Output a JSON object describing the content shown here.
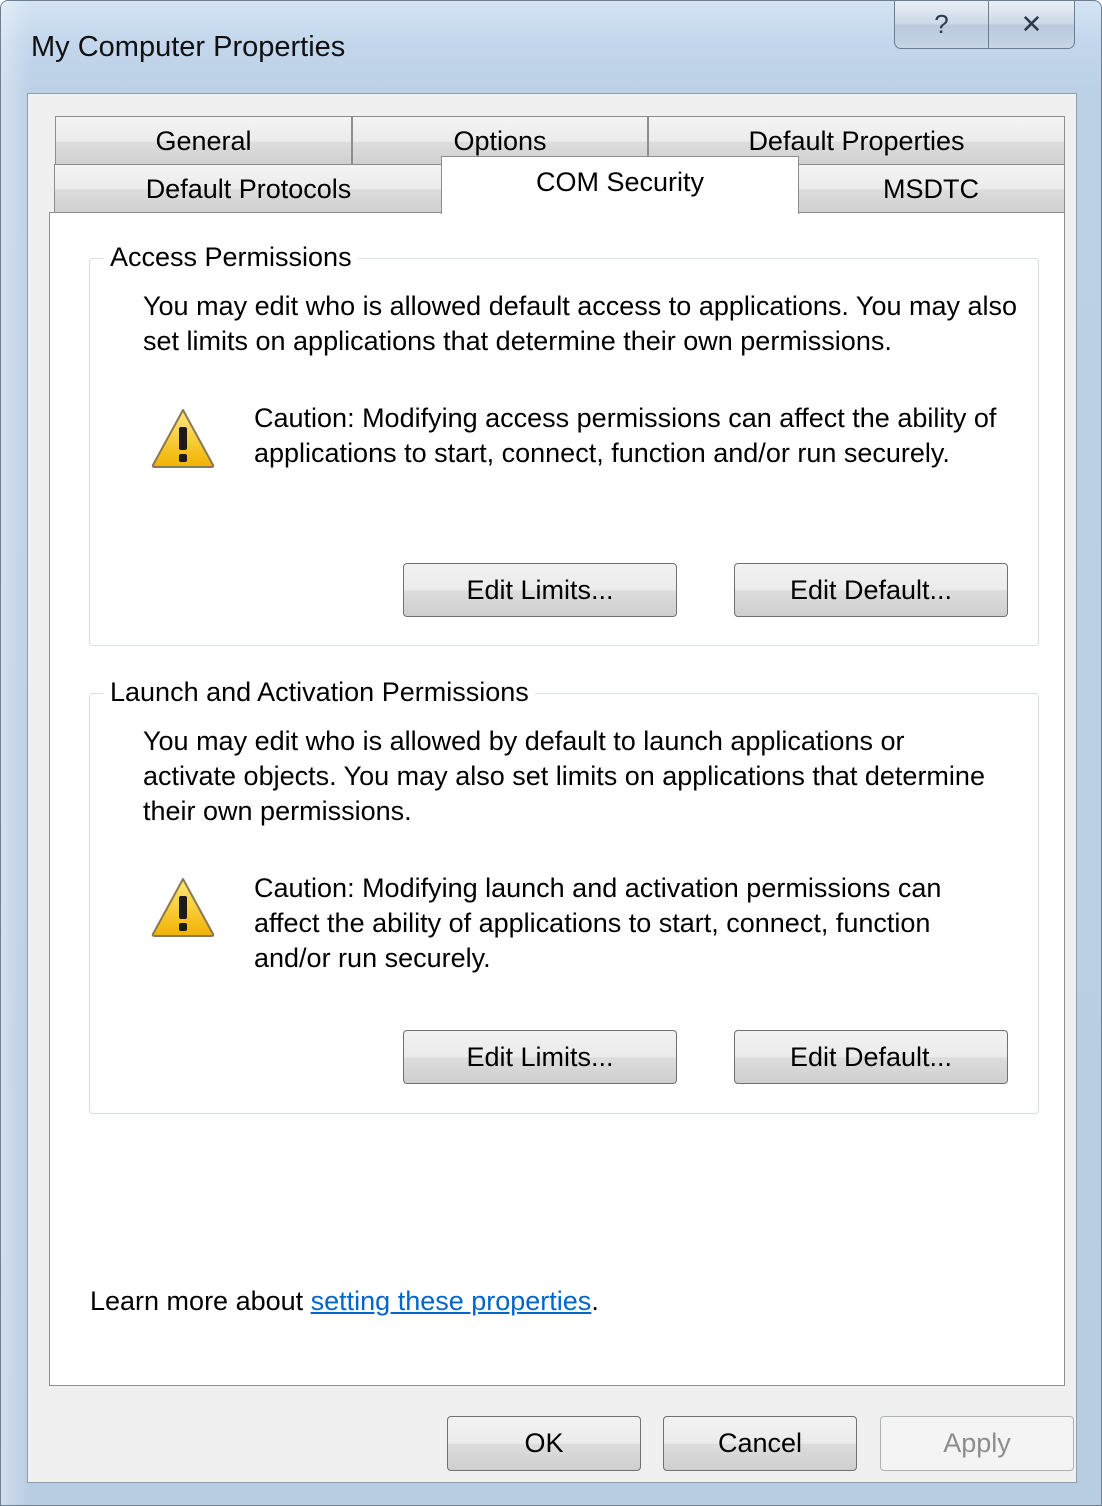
{
  "window": {
    "title": "My Computer Properties",
    "help_glyph": "?",
    "close_glyph": "✕"
  },
  "tabs": {
    "row1": [
      "General",
      "Options",
      "Default Properties"
    ],
    "row2": [
      "Default Protocols",
      "COM Security",
      "MSDTC"
    ],
    "selected": "COM Security"
  },
  "access": {
    "title": "Access Permissions",
    "description": "You may edit who is allowed default access to applications. You may also set limits on applications that determine their own permissions.",
    "caution": "Caution: Modifying access permissions can affect the ability of applications to start, connect, function and/or run securely.",
    "edit_limits_label": "Edit Limits...",
    "edit_default_label": "Edit Default..."
  },
  "launch": {
    "title": "Launch and Activation Permissions",
    "description": "You may edit who is allowed by default to launch applications or activate objects. You may also set limits on applications that determine their own permissions.",
    "caution": "Caution: Modifying launch and activation permissions can affect the ability of applications to start, connect, function and/or run securely.",
    "edit_limits_label": "Edit Limits...",
    "edit_default_label": "Edit Default..."
  },
  "learn_more": {
    "prefix": "Learn more about ",
    "link": "setting these properties",
    "suffix": "."
  },
  "footer": {
    "ok_label": "OK",
    "cancel_label": "Cancel",
    "apply_label": "Apply",
    "apply_enabled": false
  },
  "icons": {
    "warning": "warning-triangle-icon",
    "help": "help-icon",
    "close": "close-icon"
  }
}
